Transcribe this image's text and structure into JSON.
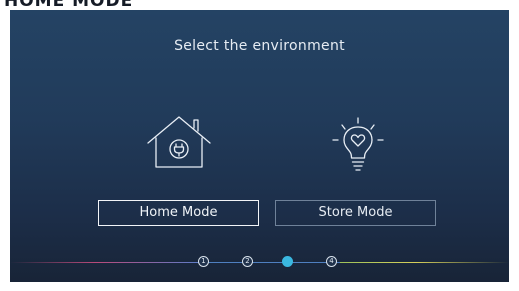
{
  "top_strip_text": "HOME MODE",
  "screen": {
    "title": "Select the environment",
    "options": [
      {
        "label": "Home Mode",
        "icon": "house-plug-icon",
        "selected": true
      },
      {
        "label": "Store Mode",
        "icon": "lightbulb-heart-icon",
        "selected": false
      }
    ],
    "steps": [
      "1",
      "2",
      "3",
      "4"
    ],
    "current_step": 3
  },
  "colors": {
    "background_top": "#244364",
    "background_bottom": "#182437",
    "active_step": "#3bb8e0",
    "text": "#e6ecf3"
  }
}
